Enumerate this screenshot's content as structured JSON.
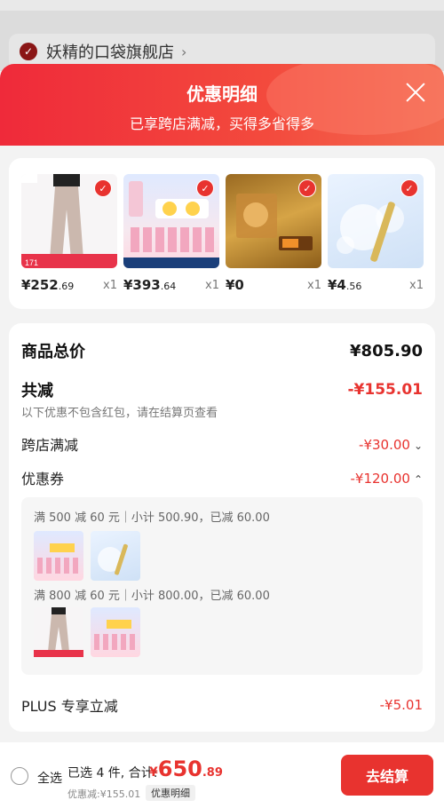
{
  "store": {
    "name": "妖精的口袋旗舰店",
    "chevron": "›"
  },
  "header": {
    "title": "优惠明细",
    "subtitle": "已享跨店满减，买得多省得多"
  },
  "products": [
    {
      "price_main": "¥252",
      "price_dec": ".69",
      "qty": "x1"
    },
    {
      "price_main": "¥393",
      "price_dec": ".64",
      "qty": "x1"
    },
    {
      "price_main": "¥0",
      "price_dec": "",
      "qty": "x1"
    },
    {
      "price_main": "¥4",
      "price_dec": ".56",
      "qty": "x1"
    }
  ],
  "summary": {
    "total_label": "商品总价",
    "total_value": "¥805.90",
    "discount_label": "共减",
    "discount_value": "-¥155.01",
    "hint": "以下优惠不包含红包，请在结算页查看",
    "cross_store_label": "跨店满减",
    "cross_store_value": "-¥30.00",
    "coupon_label": "优惠券",
    "coupon_value": "-¥120.00",
    "coupon_groups": [
      {
        "title": "满 500 减 60 元｜小计 500.90，已减 60.00"
      },
      {
        "title": "满 800 减 60 元｜小计 800.00，已减 60.00"
      }
    ],
    "plus_label": "PLUS 专享立减",
    "plus_value": "-¥5.01"
  },
  "bottom": {
    "select_all": "全选",
    "selected_info": "已选 4 件, 合计:",
    "total_yen": "¥",
    "total_main": "650",
    "total_dec": ".89",
    "discount_info": "优惠减:¥155.01",
    "detail_link": "优惠明细",
    "checkout": "去结算"
  },
  "colors": {
    "accent": "#e8332f",
    "header_gradient_start": "#ef2a3a",
    "header_gradient_end": "#f36a50"
  }
}
